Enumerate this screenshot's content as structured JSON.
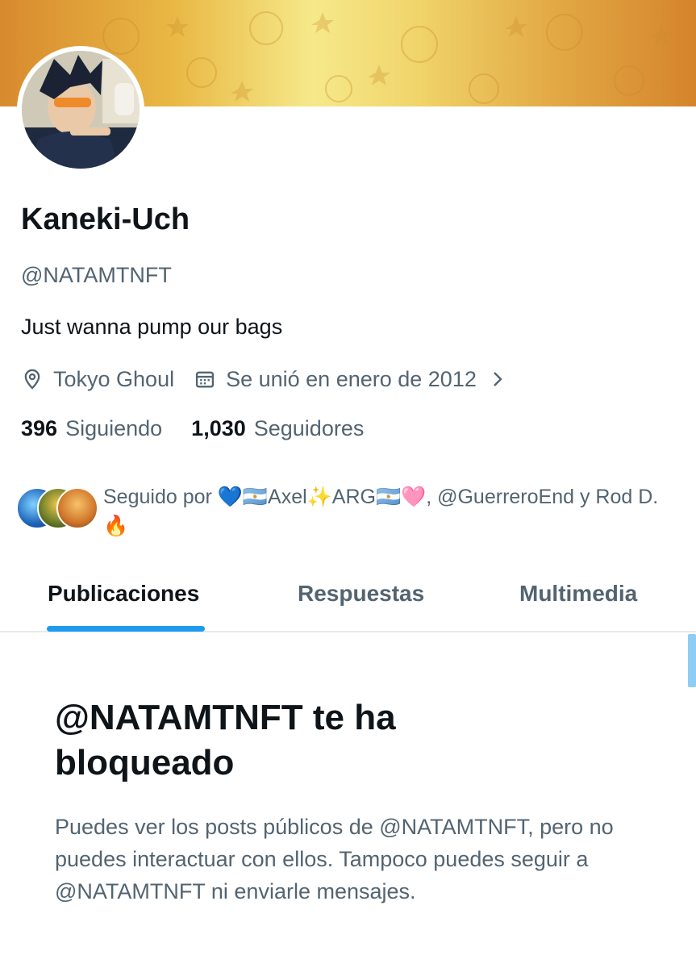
{
  "profile": {
    "display_name": "Kaneki-Uch",
    "handle": "@NATAMTNFT",
    "bio": "Just wanna pump our bags",
    "location": "Tokyo Ghoul",
    "joined": "Se unió en enero de 2012",
    "following_count": "396",
    "following_label": "Siguiendo",
    "followers_count": "1,030",
    "followers_label": "Seguidores",
    "followed_by": "Seguido por 💙🇦🇷Axel✨ARG🇦🇷🩷, @GuerreroEnd y Rod D. 🔥"
  },
  "icons": {
    "location": "location-pin-icon",
    "calendar": "calendar-icon",
    "chevron": "chevron-right-icon"
  },
  "tabs": [
    {
      "label": "Publicaciones",
      "active": true
    },
    {
      "label": "Respuestas",
      "active": false
    },
    {
      "label": "Multimedia",
      "active": false
    }
  ],
  "blocked": {
    "title": "@NATAMTNFT te ha bloqueado",
    "description": "Puedes ver los posts públicos de @NATAMTNFT, pero no puedes interactuar con ellos. Tampoco puedes seguir a @NATAMTNFT ni enviarle mensajes."
  },
  "colors": {
    "accent": "#1d9bf0",
    "secondary_text": "#536471",
    "primary_text": "#0f1419"
  }
}
